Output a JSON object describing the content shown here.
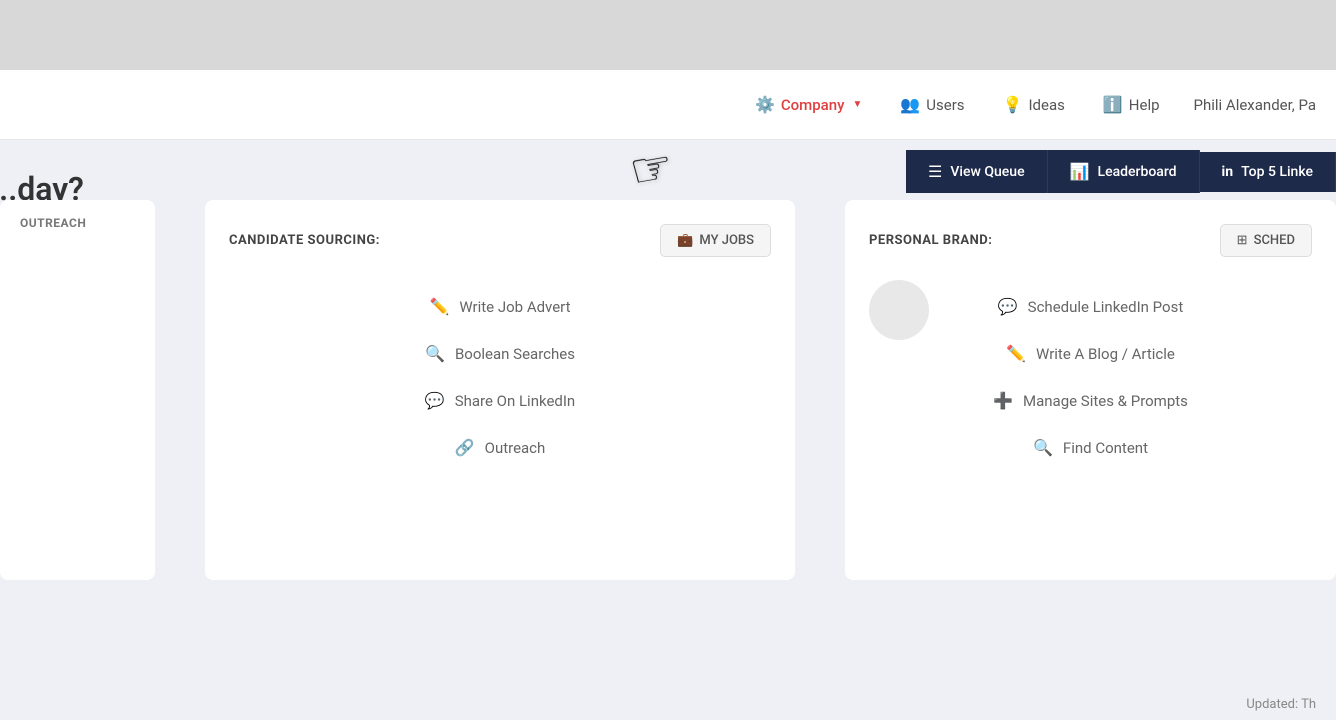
{
  "os_bar": {
    "visible": true
  },
  "navbar": {
    "company_label": "Company",
    "users_label": "Users",
    "ideas_label": "Ideas",
    "help_label": "Help",
    "user_label": "Phili Alexander, Pa"
  },
  "page": {
    "title": "...day?"
  },
  "action_bar": {
    "view_queue_label": "View Queue",
    "leaderboard_label": "Leaderboard",
    "linkedin_label": "Top 5 Linke"
  },
  "card_left": {
    "tab_label": "OUTREACH"
  },
  "card_middle": {
    "title": "CANDIDATE SOURCING:",
    "tab_btn_label": "MY JOBS",
    "menu_items": [
      {
        "icon": "✏️",
        "label": "Write Job Advert"
      },
      {
        "icon": "🔍",
        "label": "Boolean Searches"
      },
      {
        "icon": "💬",
        "label": "Share On LinkedIn"
      },
      {
        "icon": "🔗",
        "label": "Outreach"
      }
    ]
  },
  "card_right": {
    "title": "PERSONAL BRAND:",
    "tab_partial": "SCHED",
    "menu_items": [
      {
        "icon": "💬",
        "label": "Schedule LinkedIn Post"
      },
      {
        "icon": "✏️",
        "label": "Write A Blog / Article"
      },
      {
        "icon": "➕",
        "label": "Manage Sites & Prompts"
      },
      {
        "icon": "🔍",
        "label": "Find Content"
      }
    ]
  },
  "status": {
    "updated_label": "Updated: Th"
  },
  "icons": {
    "gear": "⚙️",
    "users": "👥",
    "idea": "💡",
    "help": "ℹ️",
    "menu": "☰",
    "bar_chart": "📊",
    "linkedin": "in",
    "briefcase": "💼",
    "grid": "⊞"
  }
}
